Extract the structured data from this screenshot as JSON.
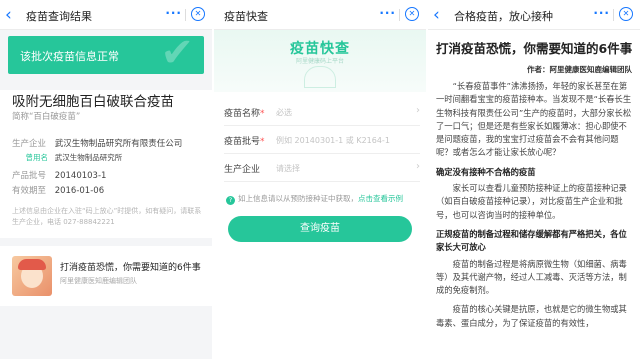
{
  "colors": {
    "accent": "#26c69a",
    "nav_icon": "#1677ff",
    "muted": "#999999"
  },
  "screen1": {
    "nav": {
      "title": "疫苗查询结果"
    },
    "banner_text": "该批次疫苗信息正常",
    "vaccine_name": "吸附无细胞百白破联合疫苗",
    "alias": "简称“百白破疫苗”",
    "fields": {
      "manufacturer_label": "生产企业",
      "manufacturer_value": "武汉生物制品研究所有限责任公司",
      "former_label": "曾用名",
      "former_value": "武汉生物制品研究所",
      "batch_label": "产品批号",
      "batch_value": "20140103-1",
      "expiry_label": "有效期至",
      "expiry_value": "2016-01-06"
    },
    "note": "上述信息由企业在入驻“码上放心”时提供，如有疑问，请联系生产企业，电话 027-88842221",
    "article": {
      "title": "打消疫苗恐慌，你需要知道的6件事",
      "source": "阿里健康医知鹿编辑团队"
    }
  },
  "screen2": {
    "nav": {
      "title": "疫苗快查"
    },
    "hero_title": "疫苗快查",
    "hero_subtitle": "阿里健康码上平台",
    "fields": [
      {
        "label": "疫苗名称",
        "required": "*",
        "placeholder": "必选"
      },
      {
        "label": "疫苗批号",
        "required": "*",
        "placeholder": "例如 20140301-1 或 K2164-1"
      },
      {
        "label": "生产企业",
        "required": "",
        "placeholder": "请选择"
      }
    ],
    "hint_icon": "?",
    "hint_text": "如上信息请以从预防接种证中获取，",
    "hint_link": "点击查看示例",
    "query_button": "查询疫苗"
  },
  "screen3": {
    "nav": {
      "title": "合格疫苗，放心接种"
    },
    "title": "打消疫苗恐慌，你需要知道的6件事",
    "author": "作者：阿里健康医知鹿编辑团队",
    "para1": "“长春疫苗事件”沸沸扬扬，年轻的家长甚至在第一时间翻看宝宝的疫苗接种本。当发现不是“长春长生生物科技有限责任公司”生产的疫苗时，大部分家长松了一口气；但是还是有些家长如履薄冰：担心即使不是问题疫苗，我的宝宝打过疫苗会不会有其他问题呢？或者怎么才能让家长放心呢？",
    "heading1": "确定没有接种不合格的疫苗",
    "para2": "家长可以查看儿童预防接种证上的疫苗接种记录（如百白破疫苗接种记录），对比疫苗生产企业和批号，也可以咨询当时的接种单位。",
    "heading2": "正规疫苗的制备过程和储存缓解都有严格把关，各位家长大可放心",
    "para3": "疫苗的制备过程是将病原微生物（如细菌、病毒等）及其代谢产物，经过人工减毒、灭活等方法，制成的免疫制剂。",
    "para4": "疫苗的核心关键是抗原，也就是它的微生物或其毒素、蛋白成分，为了保证疫苗的有效性，"
  }
}
